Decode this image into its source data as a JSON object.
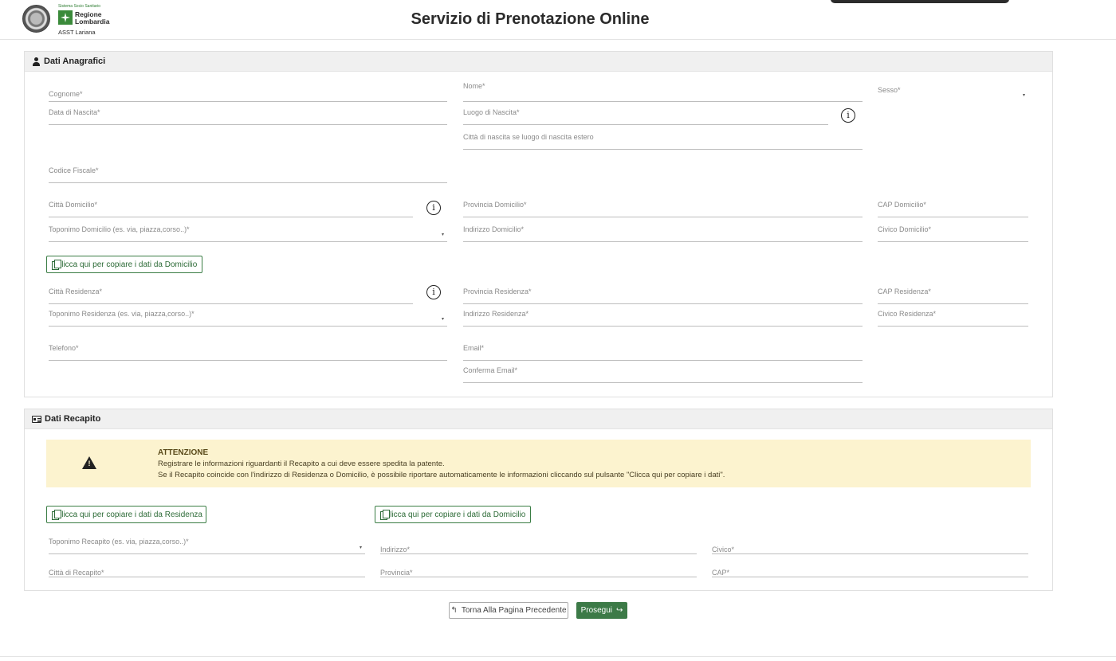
{
  "header": {
    "logo_small": "Sistema Socio Sanitario",
    "logo_region_1": "Regione",
    "logo_region_2": "Lombardia",
    "logo_asst": "ASST Lariana",
    "title": "Servizio di Prenotazione Online"
  },
  "anagrafici": {
    "title": "Dati Anagrafici",
    "cognome": "Cognome*",
    "nome": "Nome*",
    "sesso": "Sesso*",
    "data_nascita": "Data di Nascita*",
    "luogo_nascita": "Luogo di Nascita*",
    "citta_estero": "Città di nascita se luogo di nascita estero",
    "codice_fiscale": "Codice Fiscale*",
    "citta_domicilio": "Città Domicilio*",
    "provincia_domicilio": "Provincia Domicilio*",
    "cap_domicilio": "CAP Domicilio*",
    "toponimo_domicilio": "Toponimo Domicilio (es. via, piazza,corso..)*",
    "indirizzo_domicilio": "Indirizzo Domicilio*",
    "civico_domicilio": "Civico Domicilio*",
    "copy_domicilio": "Clicca qui per copiare i dati da Domicilio",
    "citta_residenza": "Città Residenza*",
    "provincia_residenza": "Provincia Residenza*",
    "cap_residenza": "CAP Residenza*",
    "toponimo_residenza": "Toponimo Residenza (es. via, piazza,corso..)*",
    "indirizzo_residenza": "Indirizzo Residenza*",
    "civico_residenza": "Civico Residenza*",
    "telefono": "Telefono*",
    "email": "Email*",
    "conferma_email": "Conferma Email*",
    "info_glyph": "i"
  },
  "recapito": {
    "title": "Dati Recapito",
    "alert_title": "ATTENZIONE",
    "alert_line1": "Registrare le informazioni riguardanti il Recapito a cui deve essere spedita la patente.",
    "alert_line2": "Se il Recapito coincide con l'indirizzo di Residenza o Domicilio, è possibile riportare automaticamente le informazioni cliccando sul pulsante \"Clicca qui per copiare i dati\".",
    "warn_glyph": "!",
    "copy_residenza": "Clicca qui per copiare i dati da Residenza",
    "copy_domicilio": "Clicca qui per copiare i dati da Domicilio",
    "toponimo": "Toponimo Recapito (es. via, piazza,corso..)*",
    "indirizzo": "Indirizzo*",
    "civico": "Civico*",
    "citta": "Città di Recapito*",
    "provincia": "Provincia*",
    "cap": "CAP*"
  },
  "actions": {
    "back_label": "Torna Alla Pagina Precedente",
    "next_label": "Prosegui",
    "back_arrow": "↰",
    "next_arrow": "↪"
  },
  "icons": {
    "user": "user-icon",
    "card": "id-card-icon",
    "info": "info-icon",
    "copy": "copy-icon",
    "warning": "warning-icon",
    "select_caret": "▾"
  },
  "colors": {
    "accent_green": "#3c7a47",
    "alert_bg": "#fcf3cf",
    "panel_header_bg": "#f0f0f0"
  }
}
